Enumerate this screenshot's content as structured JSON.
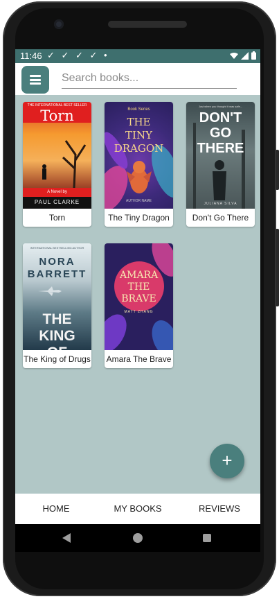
{
  "status_bar": {
    "time": "11:46",
    "icons": "✓ ✓ ✓ ✓ •",
    "wifi_icon": "wifi-icon",
    "signal_icon": "signal-icon",
    "battery_icon": "battery-icon"
  },
  "app_bar": {
    "menu_icon": "menu-icon",
    "search_placeholder": "Search books..."
  },
  "books": [
    {
      "title": "Torn",
      "cover_top": "THE INTERNATIONAL BEST SELLER",
      "cover_title": "Torn",
      "cover_sub": "A Novel by",
      "cover_author": "PAUL CLARKE"
    },
    {
      "title": "The Tiny Dragon",
      "cover_top": "Book Series",
      "cover_title": "THE TINY DRAGON",
      "cover_author": "AUTHOR NAME"
    },
    {
      "title": "Don't Go There",
      "cover_top": "Just when you thought it was safe...",
      "cover_title": "DON'T GO THERE",
      "cover_author": "JULIANA SILVA"
    },
    {
      "title": "The King of Drugs",
      "cover_top": "INTERNATIONAL BESTSELLING AUTHOR",
      "cover_author_first": "NORA",
      "cover_author_last": "BARRETT",
      "cover_title": "THE KING OF DRUGS"
    },
    {
      "title": "Amara The Brave",
      "cover_title": "AMARA THE BRAVE",
      "cover_author": "MATT ZHANG"
    }
  ],
  "fab": {
    "icon": "plus-icon",
    "label": "+"
  },
  "bottom_nav": [
    {
      "label": "HOME"
    },
    {
      "label": "MY BOOKS"
    },
    {
      "label": "REVIEWS"
    }
  ],
  "colors": {
    "accent": "#4a7f7d",
    "status_bar": "#3e6f6e",
    "background": "#b1c7c6"
  }
}
